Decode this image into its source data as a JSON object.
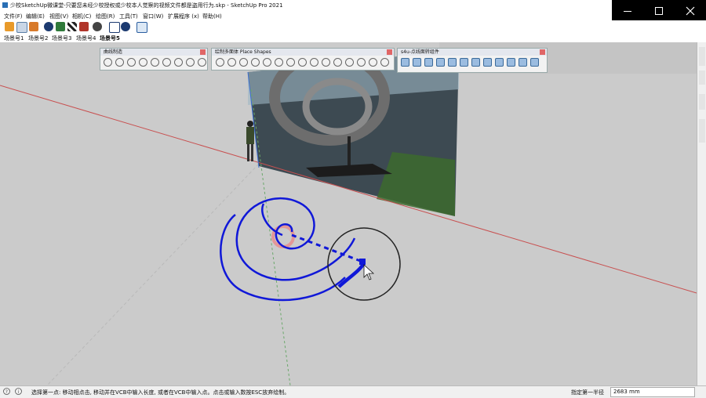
{
  "window": {
    "title": "少校SketchUp微课堂-只要您未经少校授权或少校本人觉察的视频文件都是盗用行为.skp - SketchUp Pro 2021"
  },
  "menu": [
    "文件(F)",
    "编辑(E)",
    "视图(V)",
    "相机(C)",
    "绘图(R)",
    "工具(T)",
    "窗口(W)",
    "扩展程序 (x)",
    "帮助(H)"
  ],
  "scenes": [
    "场景号1",
    "场景号2",
    "场景号3",
    "场景号4",
    "场景号5"
  ],
  "toolbars": {
    "curve": {
      "title": "曲线制造"
    },
    "shapes": {
      "title": "绘制多面体 Place Shapes"
    },
    "s4u": {
      "title": "s4u-点线面转组件"
    }
  },
  "status": {
    "prompt": "选择第一点: 移动相点击, 移动并在VCB中输入长度, 或者在VCB中输入点。点击或输入数按ESC放弃绘制。",
    "vcb_label": "指定第一半径",
    "vcb_value": "2683 mm"
  },
  "colors": {
    "spiral": "#1018d8",
    "axis_red": "#c85050",
    "panel": "#f0f0f0"
  }
}
